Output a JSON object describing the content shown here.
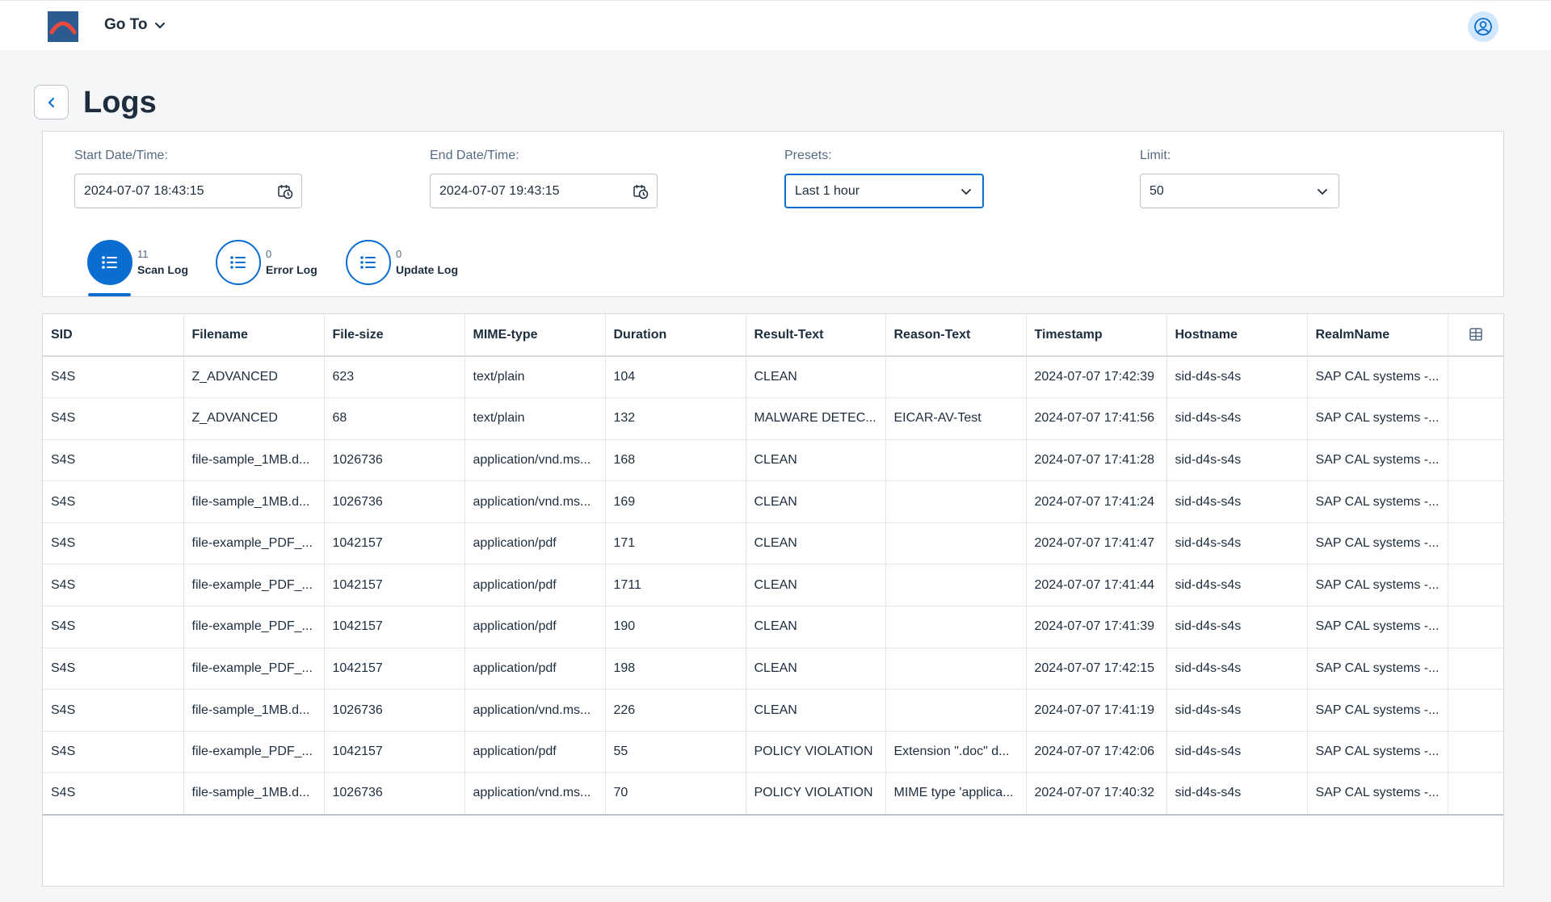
{
  "shell": {
    "goto_label": "Go To"
  },
  "page": {
    "title": "Logs"
  },
  "filters": {
    "start_label": "Start Date/Time:",
    "start_value": "2024-07-07 18:43:15",
    "end_label": "End Date/Time:",
    "end_value": "2024-07-07 19:43:15",
    "presets_label": "Presets:",
    "presets_value": "Last 1 hour",
    "limit_label": "Limit:",
    "limit_value": "50"
  },
  "tabs": [
    {
      "count": "11",
      "label": "Scan Log",
      "selected": true
    },
    {
      "count": "0",
      "label": "Error Log",
      "selected": false
    },
    {
      "count": "0",
      "label": "Update Log",
      "selected": false
    }
  ],
  "table": {
    "columns": [
      "SID",
      "Filename",
      "File-size",
      "MIME-type",
      "Duration",
      "Result-Text",
      "Reason-Text",
      "Timestamp",
      "Hostname",
      "RealmName"
    ],
    "rows": [
      [
        "S4S",
        "Z_ADVANCED",
        "623",
        "text/plain",
        "104",
        "CLEAN",
        "",
        "2024-07-07 17:42:39",
        "sid-d4s-s4s",
        "SAP CAL systems -..."
      ],
      [
        "S4S",
        "Z_ADVANCED",
        "68",
        "text/plain",
        "132",
        "MALWARE DETEC...",
        "EICAR-AV-Test",
        "2024-07-07 17:41:56",
        "sid-d4s-s4s",
        "SAP CAL systems -..."
      ],
      [
        "S4S",
        "file-sample_1MB.d...",
        "1026736",
        "application/vnd.ms...",
        "168",
        "CLEAN",
        "",
        "2024-07-07 17:41:28",
        "sid-d4s-s4s",
        "SAP CAL systems -..."
      ],
      [
        "S4S",
        "file-sample_1MB.d...",
        "1026736",
        "application/vnd.ms...",
        "169",
        "CLEAN",
        "",
        "2024-07-07 17:41:24",
        "sid-d4s-s4s",
        "SAP CAL systems -..."
      ],
      [
        "S4S",
        "file-example_PDF_...",
        "1042157",
        "application/pdf",
        "171",
        "CLEAN",
        "",
        "2024-07-07 17:41:47",
        "sid-d4s-s4s",
        "SAP CAL systems -..."
      ],
      [
        "S4S",
        "file-example_PDF_...",
        "1042157",
        "application/pdf",
        "1711",
        "CLEAN",
        "",
        "2024-07-07 17:41:44",
        "sid-d4s-s4s",
        "SAP CAL systems -..."
      ],
      [
        "S4S",
        "file-example_PDF_...",
        "1042157",
        "application/pdf",
        "190",
        "CLEAN",
        "",
        "2024-07-07 17:41:39",
        "sid-d4s-s4s",
        "SAP CAL systems -..."
      ],
      [
        "S4S",
        "file-example_PDF_...",
        "1042157",
        "application/pdf",
        "198",
        "CLEAN",
        "",
        "2024-07-07 17:42:15",
        "sid-d4s-s4s",
        "SAP CAL systems -..."
      ],
      [
        "S4S",
        "file-sample_1MB.d...",
        "1026736",
        "application/vnd.ms...",
        "226",
        "CLEAN",
        "",
        "2024-07-07 17:41:19",
        "sid-d4s-s4s",
        "SAP CAL systems -..."
      ],
      [
        "S4S",
        "file-example_PDF_...",
        "1042157",
        "application/pdf",
        "55",
        "POLICY VIOLATION",
        "Extension \".doc\" d...",
        "2024-07-07 17:42:06",
        "sid-d4s-s4s",
        "SAP CAL systems -..."
      ],
      [
        "S4S",
        "file-sample_1MB.d...",
        "1026736",
        "application/vnd.ms...",
        "70",
        "POLICY VIOLATION",
        "MIME type 'applica...",
        "2024-07-07 17:40:32",
        "sid-d4s-s4s",
        "SAP CAL systems -..."
      ]
    ]
  },
  "colors": {
    "brand": "#0a6ed1",
    "logo_bg": "#2c5b91",
    "logo_arc": "#e84b3c"
  },
  "icons": {
    "logo": "company-logo",
    "goto_chevron": "chevron-down-icon",
    "avatar": "user-avatar-icon",
    "back": "chevron-left-icon",
    "date_picker": "calendar-clock-icon",
    "select": "chevron-down-icon",
    "tab": "list-icon",
    "table_settings": "table-settings-icon"
  }
}
